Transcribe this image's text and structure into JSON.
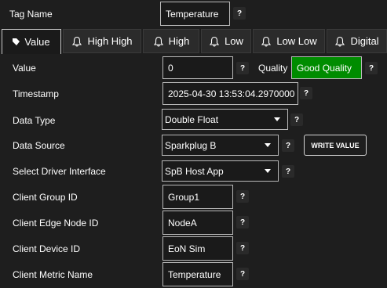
{
  "header": {
    "tag_name_label": "Tag Name",
    "tag_name_value": "Temperature"
  },
  "tabs": [
    {
      "label": "Value",
      "icon": "tag-icon"
    },
    {
      "label": "High High",
      "icon": "bell-icon"
    },
    {
      "label": "High",
      "icon": "bell-icon"
    },
    {
      "label": "Low",
      "icon": "bell-icon"
    },
    {
      "label": "Low Low",
      "icon": "bell-icon"
    },
    {
      "label": "Digital",
      "icon": "bell-icon"
    }
  ],
  "form": {
    "value_label": "Value",
    "value": "0",
    "quality_label": "Quality",
    "quality_value": "Good Quality",
    "timestamp_label": "Timestamp",
    "timestamp_value": "2025-04-30 13:53:04.2970000",
    "data_type_label": "Data Type",
    "data_type_value": "Double Float",
    "data_source_label": "Data Source",
    "data_source_value": "Sparkplug B",
    "write_value_button": "WRITE VALUE",
    "driver_label": "Select Driver Interface",
    "driver_value": "SpB Host App",
    "group_id_label": "Client Group ID",
    "group_id_value": "Group1",
    "edge_node_label": "Client Edge Node ID",
    "edge_node_value": "NodeA",
    "device_id_label": "Client Device ID",
    "device_id_value": "EoN Sim",
    "metric_name_label": "Client Metric Name",
    "metric_name_value": "Temperature"
  },
  "help_symbol": "?",
  "colors": {
    "background": "#1e1e1e",
    "quality_good": "#008c00",
    "field_border": "#b9b9b9"
  }
}
